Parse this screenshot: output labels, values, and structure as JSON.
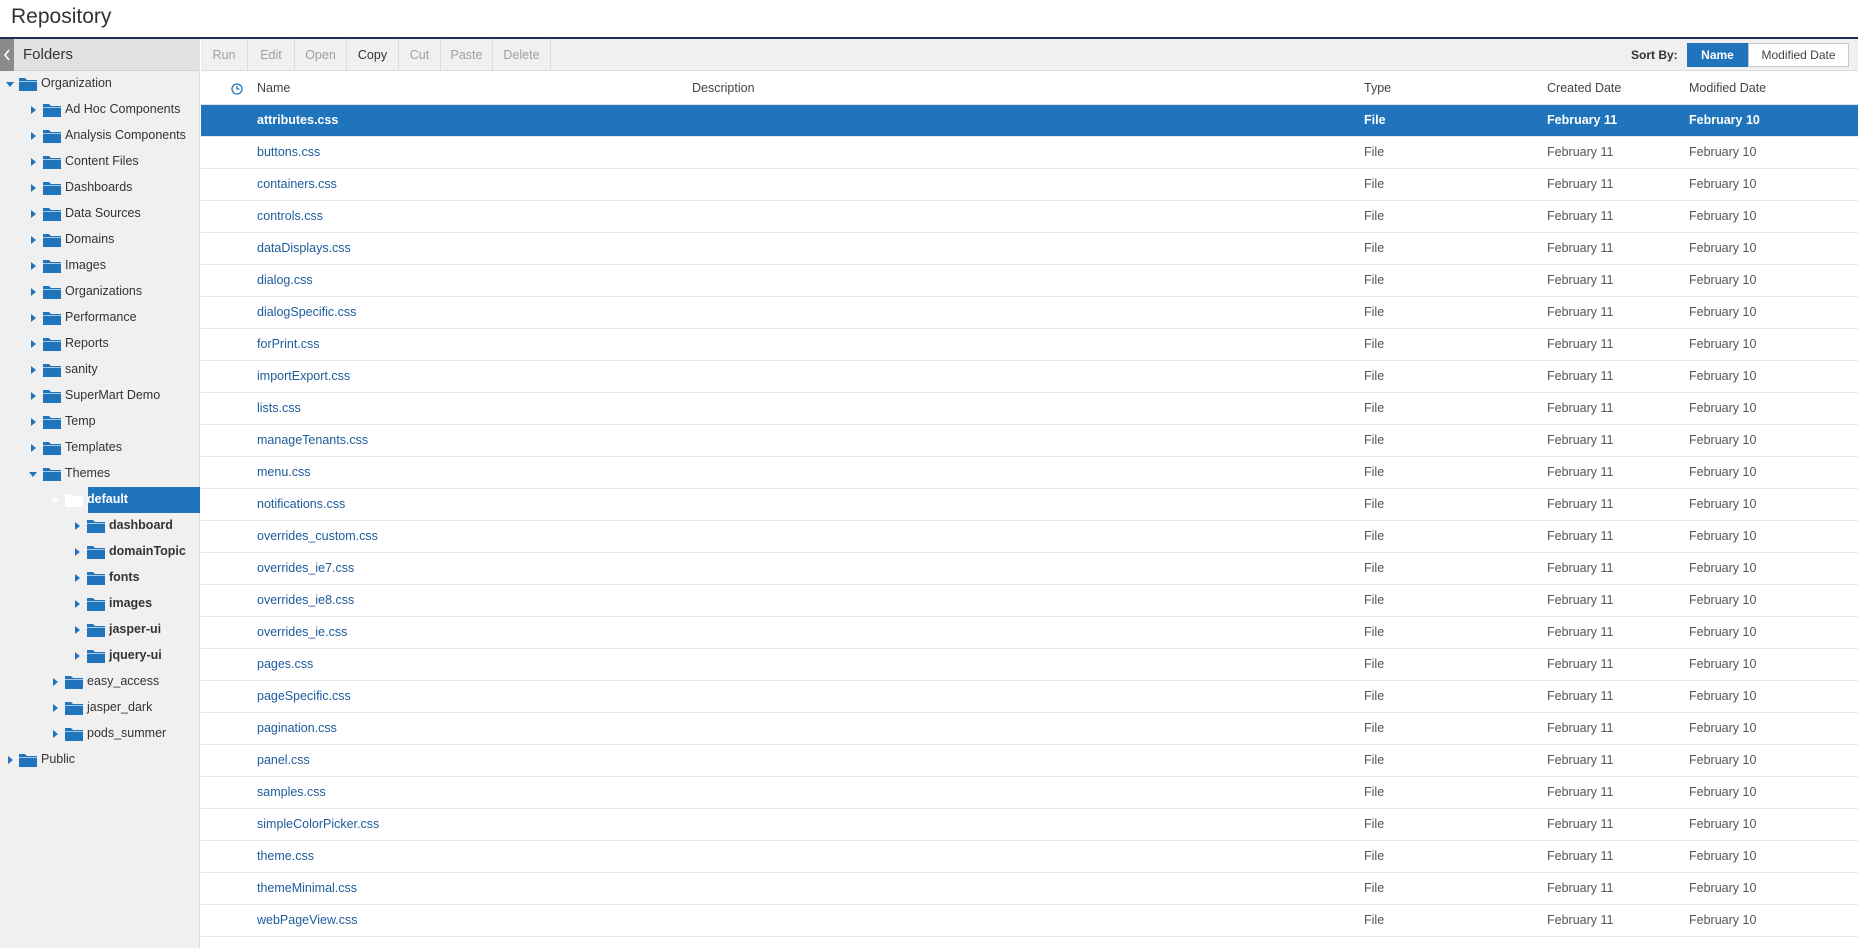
{
  "titlebar": {
    "title": "Repository"
  },
  "sidebar": {
    "header_label": "Folders",
    "tree": [
      {
        "label": "Organization",
        "depth": 0,
        "expanded": true,
        "bold": false,
        "selected": false
      },
      {
        "label": "Ad Hoc Components",
        "depth": 1,
        "expanded": false,
        "bold": false,
        "selected": false
      },
      {
        "label": "Analysis Components",
        "depth": 1,
        "expanded": false,
        "bold": false,
        "selected": false
      },
      {
        "label": "Content Files",
        "depth": 1,
        "expanded": false,
        "bold": false,
        "selected": false
      },
      {
        "label": "Dashboards",
        "depth": 1,
        "expanded": false,
        "bold": false,
        "selected": false
      },
      {
        "label": "Data Sources",
        "depth": 1,
        "expanded": false,
        "bold": false,
        "selected": false
      },
      {
        "label": "Domains",
        "depth": 1,
        "expanded": false,
        "bold": false,
        "selected": false
      },
      {
        "label": "Images",
        "depth": 1,
        "expanded": false,
        "bold": false,
        "selected": false
      },
      {
        "label": "Organizations",
        "depth": 1,
        "expanded": false,
        "bold": false,
        "selected": false
      },
      {
        "label": "Performance",
        "depth": 1,
        "expanded": false,
        "bold": false,
        "selected": false
      },
      {
        "label": "Reports",
        "depth": 1,
        "expanded": false,
        "bold": false,
        "selected": false
      },
      {
        "label": "sanity",
        "depth": 1,
        "expanded": false,
        "bold": false,
        "selected": false
      },
      {
        "label": "SuperMart Demo",
        "depth": 1,
        "expanded": false,
        "bold": false,
        "selected": false
      },
      {
        "label": "Temp",
        "depth": 1,
        "expanded": false,
        "bold": false,
        "selected": false
      },
      {
        "label": "Templates",
        "depth": 1,
        "expanded": false,
        "bold": false,
        "selected": false
      },
      {
        "label": "Themes",
        "depth": 1,
        "expanded": true,
        "bold": false,
        "selected": false
      },
      {
        "label": "default",
        "depth": 2,
        "expanded": true,
        "bold": true,
        "selected": true
      },
      {
        "label": "dashboard",
        "depth": 3,
        "expanded": false,
        "bold": true,
        "selected": false
      },
      {
        "label": "domainTopic",
        "depth": 3,
        "expanded": false,
        "bold": true,
        "selected": false
      },
      {
        "label": "fonts",
        "depth": 3,
        "expanded": false,
        "bold": true,
        "selected": false
      },
      {
        "label": "images",
        "depth": 3,
        "expanded": false,
        "bold": true,
        "selected": false
      },
      {
        "label": "jasper-ui",
        "depth": 3,
        "expanded": false,
        "bold": true,
        "selected": false
      },
      {
        "label": "jquery-ui",
        "depth": 3,
        "expanded": false,
        "bold": true,
        "selected": false
      },
      {
        "label": "easy_access",
        "depth": 2,
        "expanded": false,
        "bold": false,
        "selected": false
      },
      {
        "label": "jasper_dark",
        "depth": 2,
        "expanded": false,
        "bold": false,
        "selected": false
      },
      {
        "label": "pods_summer",
        "depth": 2,
        "expanded": false,
        "bold": false,
        "selected": false
      },
      {
        "label": "Public",
        "depth": 0,
        "expanded": false,
        "bold": false,
        "selected": false
      }
    ]
  },
  "toolbar": {
    "buttons": [
      {
        "label": "Run",
        "enabled": false
      },
      {
        "label": "Edit",
        "enabled": false
      },
      {
        "label": "Open",
        "enabled": false
      },
      {
        "label": "Copy",
        "enabled": true
      },
      {
        "label": "Cut",
        "enabled": false
      },
      {
        "label": "Paste",
        "enabled": false
      },
      {
        "label": "Delete",
        "enabled": false
      }
    ],
    "sort_label": "Sort By:",
    "sort_options": [
      {
        "label": "Name",
        "active": true
      },
      {
        "label": "Modified Date",
        "active": false
      }
    ]
  },
  "list": {
    "columns": {
      "name": "Name",
      "description": "Description",
      "type": "Type",
      "created": "Created Date",
      "modified": "Modified Date"
    },
    "rows": [
      {
        "name": "attributes.css",
        "description": "",
        "type": "File",
        "created": "February 11",
        "modified": "February 10",
        "selected": true
      },
      {
        "name": "buttons.css",
        "description": "",
        "type": "File",
        "created": "February 11",
        "modified": "February 10",
        "selected": false
      },
      {
        "name": "containers.css",
        "description": "",
        "type": "File",
        "created": "February 11",
        "modified": "February 10",
        "selected": false
      },
      {
        "name": "controls.css",
        "description": "",
        "type": "File",
        "created": "February 11",
        "modified": "February 10",
        "selected": false
      },
      {
        "name": "dataDisplays.css",
        "description": "",
        "type": "File",
        "created": "February 11",
        "modified": "February 10",
        "selected": false
      },
      {
        "name": "dialog.css",
        "description": "",
        "type": "File",
        "created": "February 11",
        "modified": "February 10",
        "selected": false
      },
      {
        "name": "dialogSpecific.css",
        "description": "",
        "type": "File",
        "created": "February 11",
        "modified": "February 10",
        "selected": false
      },
      {
        "name": "forPrint.css",
        "description": "",
        "type": "File",
        "created": "February 11",
        "modified": "February 10",
        "selected": false
      },
      {
        "name": "importExport.css",
        "description": "",
        "type": "File",
        "created": "February 11",
        "modified": "February 10",
        "selected": false
      },
      {
        "name": "lists.css",
        "description": "",
        "type": "File",
        "created": "February 11",
        "modified": "February 10",
        "selected": false
      },
      {
        "name": "manageTenants.css",
        "description": "",
        "type": "File",
        "created": "February 11",
        "modified": "February 10",
        "selected": false
      },
      {
        "name": "menu.css",
        "description": "",
        "type": "File",
        "created": "February 11",
        "modified": "February 10",
        "selected": false
      },
      {
        "name": "notifications.css",
        "description": "",
        "type": "File",
        "created": "February 11",
        "modified": "February 10",
        "selected": false
      },
      {
        "name": "overrides_custom.css",
        "description": "",
        "type": "File",
        "created": "February 11",
        "modified": "February 10",
        "selected": false
      },
      {
        "name": "overrides_ie7.css",
        "description": "",
        "type": "File",
        "created": "February 11",
        "modified": "February 10",
        "selected": false
      },
      {
        "name": "overrides_ie8.css",
        "description": "",
        "type": "File",
        "created": "February 11",
        "modified": "February 10",
        "selected": false
      },
      {
        "name": "overrides_ie.css",
        "description": "",
        "type": "File",
        "created": "February 11",
        "modified": "February 10",
        "selected": false
      },
      {
        "name": "pages.css",
        "description": "",
        "type": "File",
        "created": "February 11",
        "modified": "February 10",
        "selected": false
      },
      {
        "name": "pageSpecific.css",
        "description": "",
        "type": "File",
        "created": "February 11",
        "modified": "February 10",
        "selected": false
      },
      {
        "name": "pagination.css",
        "description": "",
        "type": "File",
        "created": "February 11",
        "modified": "February 10",
        "selected": false
      },
      {
        "name": "panel.css",
        "description": "",
        "type": "File",
        "created": "February 11",
        "modified": "February 10",
        "selected": false
      },
      {
        "name": "samples.css",
        "description": "",
        "type": "File",
        "created": "February 11",
        "modified": "February 10",
        "selected": false
      },
      {
        "name": "simpleColorPicker.css",
        "description": "",
        "type": "File",
        "created": "February 11",
        "modified": "February 10",
        "selected": false
      },
      {
        "name": "theme.css",
        "description": "",
        "type": "File",
        "created": "February 11",
        "modified": "February 10",
        "selected": false
      },
      {
        "name": "themeMinimal.css",
        "description": "",
        "type": "File",
        "created": "February 11",
        "modified": "February 10",
        "selected": false
      },
      {
        "name": "webPageView.css",
        "description": "",
        "type": "File",
        "created": "February 11",
        "modified": "February 10",
        "selected": false
      }
    ]
  },
  "colors": {
    "accent": "#1f74bc",
    "header_border": "#1f2f4f",
    "folder": "#1f74bc",
    "link": "#1c5c9c"
  },
  "icons": {
    "folder": "folder-icon",
    "collapse": "chevron-left-icon",
    "expand": "triangle-right-icon",
    "expanded": "triangle-down-icon",
    "clock": "clock-icon"
  }
}
